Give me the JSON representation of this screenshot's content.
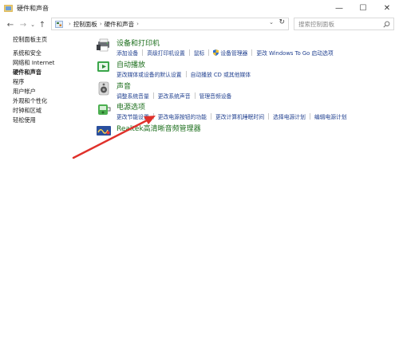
{
  "window": {
    "title": "硬件和声音",
    "controls": {
      "minimize": "—",
      "maximize": "☐",
      "close": "✕"
    }
  },
  "navigation": {
    "back": "←",
    "forward": "→",
    "recent": "⌄",
    "up": "↑",
    "breadcrumbs": [
      "控制面板",
      "硬件和声音"
    ],
    "crumb_separator": "›",
    "dropdown": "⌄",
    "refresh": "↻",
    "search_placeholder": "搜索控制面板"
  },
  "sidebar": {
    "items": [
      {
        "label": "控制面板主页"
      },
      {
        "label": "系统和安全"
      },
      {
        "label": "网络和 Internet"
      },
      {
        "label": "硬件和声音"
      },
      {
        "label": "程序"
      },
      {
        "label": "用户帐户"
      },
      {
        "label": "外观和个性化"
      },
      {
        "label": "时钟和区域"
      },
      {
        "label": "轻松使用"
      }
    ],
    "active_index": 3
  },
  "categories": [
    {
      "title": "设备和打印机",
      "icon": "printer-icon",
      "links": [
        "添加设备",
        "高级打印机设置",
        "鼠标",
        "设备管理器",
        "更改 Windows To Go 启动选项"
      ]
    },
    {
      "title": "自动播放",
      "icon": "autoplay-icon",
      "links": [
        "更改媒体或设备的默认设置",
        "自动播放 CD 或其他媒体"
      ]
    },
    {
      "title": "声音",
      "icon": "speaker-icon",
      "links": [
        "调整系统音量",
        "更改系统声音",
        "管理音频设备"
      ]
    },
    {
      "title": "电源选项",
      "icon": "power-options-icon",
      "links": [
        "更改节能设置",
        "更改电源按钮的功能",
        "更改计算机睡眠时间",
        "选择电源计划",
        "编辑电源计划"
      ]
    },
    {
      "title": "Realtek高清晰音频管理器",
      "icon": "realtek-icon",
      "links": []
    }
  ],
  "annotation": {
    "color": "#e0312b",
    "points_to": "更改电源按钮的功能"
  },
  "colors": {
    "category_title": "#1c6e1c",
    "link": "#1f3f8f",
    "arrow": "#e0312b"
  }
}
